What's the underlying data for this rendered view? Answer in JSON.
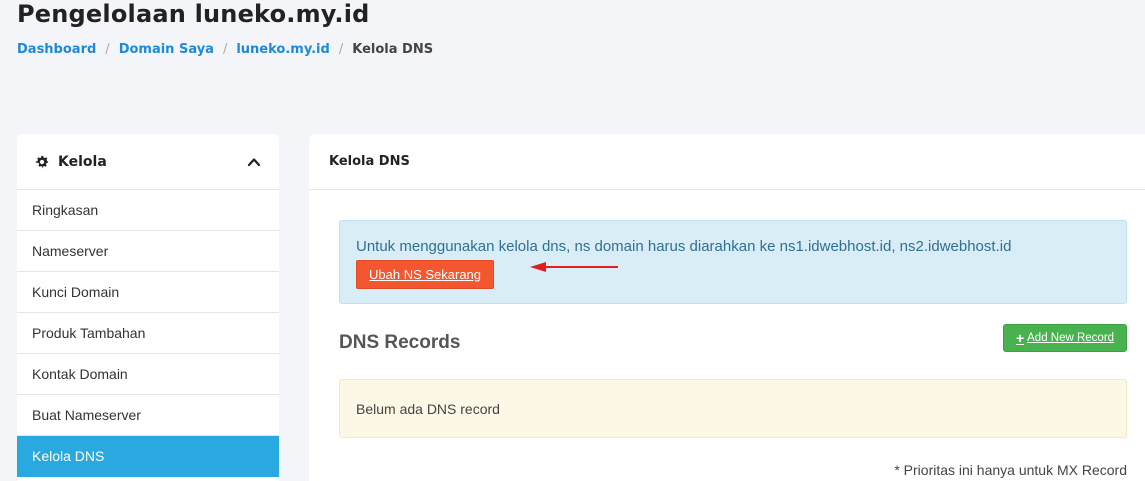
{
  "page": {
    "title": "Pengelolaan luneko.my.id"
  },
  "breadcrumb": {
    "items": [
      "Dashboard",
      "Domain Saya",
      "luneko.my.id"
    ],
    "current": "Kelola DNS",
    "separator": "/"
  },
  "sidebar": {
    "header": "Kelola",
    "items": [
      {
        "label": "Ringkasan"
      },
      {
        "label": "Nameserver"
      },
      {
        "label": "Kunci Domain"
      },
      {
        "label": "Produk Tambahan"
      },
      {
        "label": "Kontak Domain"
      },
      {
        "label": "Buat Nameserver"
      },
      {
        "label": "Kelola DNS"
      }
    ],
    "active_color": "#29a9e0"
  },
  "main": {
    "header": "Kelola DNS",
    "info_alert": {
      "message": "Untuk menggunakan kelola dns, ns domain harus diarahkan ke ns1.idwebhost.id, ns2.idwebhost.id",
      "button_label": "Ubah NS Sekarang"
    },
    "dns_records_title": "DNS Records",
    "add_button_label": "Add New Record",
    "empty_message": "Belum ada DNS record",
    "note": "* Prioritas ini hanya untuk MX Record"
  },
  "icons": {
    "sidebar_header": "gear-icon",
    "sidebar_toggle": "chevron-up-icon",
    "add_button": "plus-icon",
    "annotation": "red-arrow-icon"
  }
}
